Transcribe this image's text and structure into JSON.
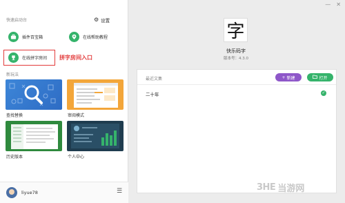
{
  "window": {
    "minimize": "—",
    "close": "✕"
  },
  "left": {
    "quick_start_title": "快速启动台",
    "settings_label": "设置",
    "quick_items": [
      {
        "label": "插件百宝箱",
        "icon": "briefcase-icon"
      },
      {
        "label": "在线帮助教程",
        "icon": "location-pin-icon"
      },
      {
        "label": "在线拼字房间",
        "icon": "trophy-icon"
      }
    ],
    "annotation": "拼字房间入口",
    "new_features_title": "新玩法",
    "tiles": [
      {
        "label": "查找替换"
      },
      {
        "label": "审阅模式"
      },
      {
        "label": "历史版本"
      },
      {
        "label": "个人中心"
      }
    ]
  },
  "user": {
    "username": "liyue78"
  },
  "right": {
    "app_logo_char": "字",
    "app_name": "快乐码字",
    "version": "版本号：4.3.0",
    "recent_title": "最近文集",
    "new_button": "新建",
    "open_button": "打开",
    "documents": [
      {
        "name": "二十年",
        "status": "synced"
      }
    ]
  },
  "watermark": {
    "logo": "3HE",
    "text": "当游网"
  },
  "colors": {
    "green": "#35b36b",
    "purple": "#8e57c9",
    "red": "#e23a3a"
  }
}
